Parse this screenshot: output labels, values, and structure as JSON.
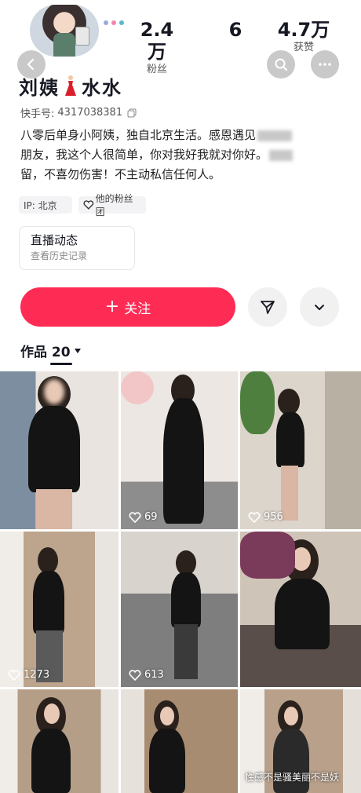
{
  "profile": {
    "name_part1": "刘姨",
    "name_icon": "red-dress-icon",
    "name_part2": "水水",
    "uid_label": "快手号:",
    "uid_value": "4317038381",
    "bio_line1": "八零后单身小阿姨，独自北京生活。感恩遇见",
    "bio_line2": "朋友，我这个人很简单，你对我好我就对你好。",
    "bio_line3": "留，不喜勿伤害！不主动私信任何人。",
    "ip_label": "IP: 北京",
    "fan_group_label": "他的粉丝团"
  },
  "stats": {
    "fans_value": "2.4万",
    "fans_label": "粉丝",
    "following_value": "6",
    "likes_value": "4.7万",
    "likes_label": "获赞"
  },
  "live": {
    "title": "直播动态",
    "subtitle": "查看历史记录"
  },
  "actions": {
    "follow_label": "关注",
    "follow_plus": "+",
    "accent": "#fe2c55"
  },
  "works": {
    "tab_label": "作品 20"
  },
  "grid": {
    "items": [
      {
        "likes": ""
      },
      {
        "likes": "69"
      },
      {
        "likes": "956"
      },
      {
        "likes": "1273"
      },
      {
        "likes": "613"
      },
      {
        "likes": ""
      },
      {
        "likes": ""
      },
      {
        "likes": ""
      },
      {
        "likes": "",
        "caption": "性感不是骚美丽不是妖"
      }
    ]
  }
}
